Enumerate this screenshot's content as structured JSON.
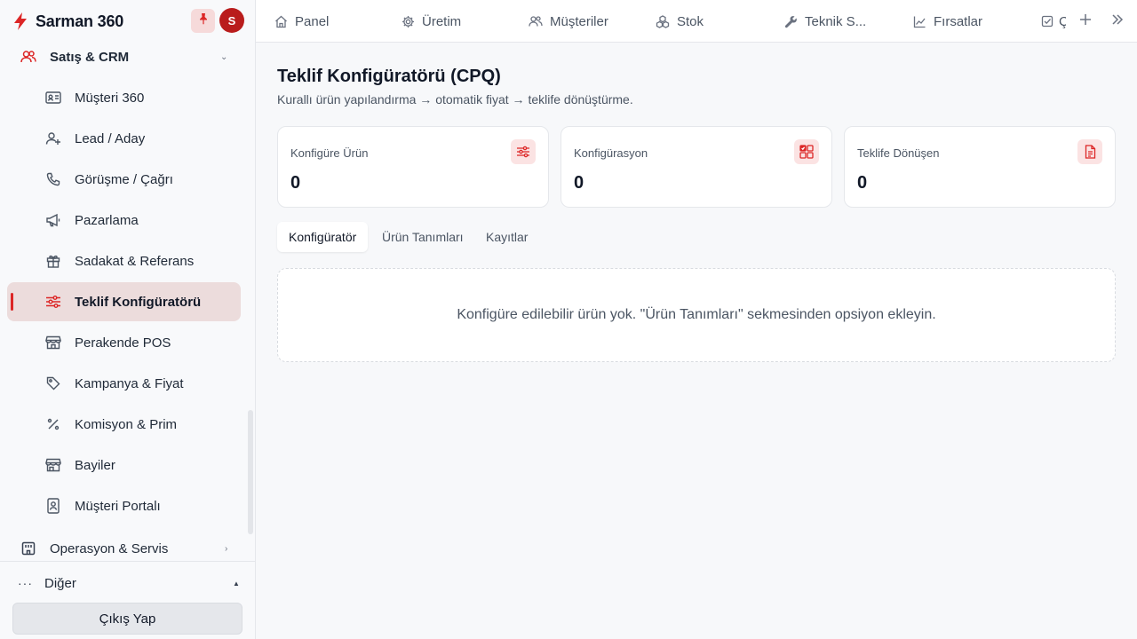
{
  "app": {
    "name": "Sarman 360",
    "avatar_initial": "S",
    "accent": "#dc2626",
    "brand_icon": "bolt-icon"
  },
  "sidebar": {
    "group_sales": {
      "label": "Satış & CRM",
      "icon": "users-icon",
      "chevron": "⌄"
    },
    "items": [
      {
        "label": "Müşteri 360",
        "icon": "id-card-icon"
      },
      {
        "label": "Lead / Aday",
        "icon": "user-plus-icon"
      },
      {
        "label": "Görüşme / Çağrı",
        "icon": "phone-icon"
      },
      {
        "label": "Pazarlama",
        "icon": "megaphone-icon"
      },
      {
        "label": "Sadakat & Referans",
        "icon": "gift-icon"
      },
      {
        "label": "Teklif Konfigüratörü",
        "icon": "sliders-icon",
        "active": true
      },
      {
        "label": "Perakende POS",
        "icon": "store-icon"
      },
      {
        "label": "Kampanya & Fiyat",
        "icon": "tag-icon"
      },
      {
        "label": "Komisyon & Prim",
        "icon": "percent-icon"
      },
      {
        "label": "Bayiler",
        "icon": "storefront-icon"
      },
      {
        "label": "Müşteri Portalı",
        "icon": "portal-icon"
      }
    ],
    "group_ops": {
      "label": "Operasyon & Servis",
      "icon": "building-icon",
      "chevron": "›"
    },
    "other": {
      "label": "Diğer",
      "icon": "···",
      "chevron": "▲"
    },
    "logout_label": "Çıkış Yap"
  },
  "topbar": {
    "tabs": [
      {
        "label": "Panel",
        "icon": "home-icon"
      },
      {
        "label": "Üretim",
        "icon": "gear-icon"
      },
      {
        "label": "Müşteriler",
        "icon": "users-icon"
      },
      {
        "label": "Stok",
        "icon": "boxes-icon"
      },
      {
        "label": "Teknik S...",
        "icon": "wrench-icon"
      },
      {
        "label": "Fırsatlar",
        "icon": "chart-line-icon"
      },
      {
        "label": "Ç",
        "icon": "check-square-icon"
      }
    ]
  },
  "page": {
    "title": "Teklif Konfigüratörü (CPQ)",
    "subtitle": "Kurallı ürün yapılandırma → otomatik fiyat → teklife dönüştürme.",
    "stats": [
      {
        "label": "Konfigüre Ürün",
        "value": "0",
        "icon": "sliders-icon"
      },
      {
        "label": "Konfigürasyon",
        "value": "0",
        "icon": "grid-check-icon"
      },
      {
        "label": "Teklife Dönüşen",
        "value": "0",
        "icon": "document-icon"
      }
    ],
    "tabs": [
      {
        "label": "Konfigüratör",
        "active": true
      },
      {
        "label": "Ürün Tanımları"
      },
      {
        "label": "Kayıtlar"
      }
    ],
    "empty_message": "Konfigüre edilebilir ürün yok. \"Ürün Tanımları\" sekmesinden opsiyon ekleyin."
  }
}
